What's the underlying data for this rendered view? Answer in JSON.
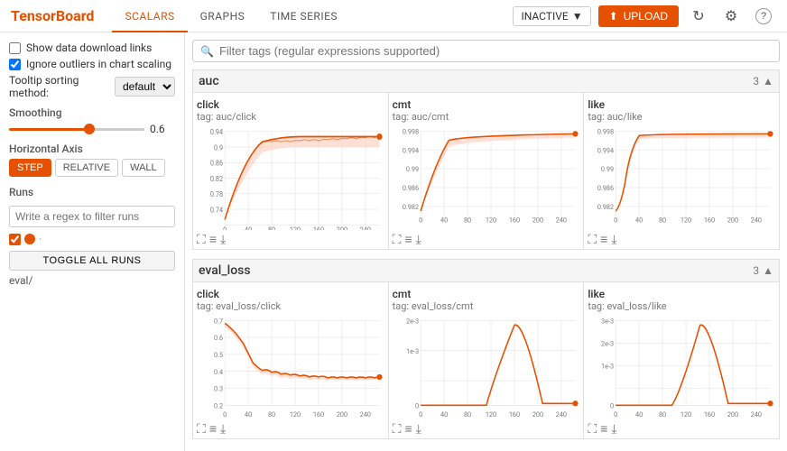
{
  "header": {
    "logo": "TensorBoard",
    "nav": [
      "SCALARS",
      "GRAPHS",
      "TIME SERIES"
    ],
    "active_nav": "SCALARS",
    "inactive_label": "INACTIVE",
    "upload_label": "UPLOAD"
  },
  "sidebar": {
    "show_download": "Show data download links",
    "ignore_outliers": "Ignore outliers in chart scaling",
    "tooltip_label": "Tooltip sorting method:",
    "tooltip_default": "default",
    "smoothing_label": "Smoothing",
    "smoothing_value": "0.6",
    "horizontal_axis_label": "Horizontal Axis",
    "axis_buttons": [
      "STEP",
      "RELATIVE",
      "WALL"
    ],
    "active_axis": "STEP",
    "runs_label": "Runs",
    "runs_placeholder": "Write a regex to filter runs",
    "toggle_runs": "TOGGLE ALL RUNS",
    "run_name": "eval/"
  },
  "search": {
    "placeholder": "Filter tags (regular expressions supported)"
  },
  "sections": [
    {
      "name": "auc",
      "count": "3",
      "charts": [
        {
          "title": "click",
          "tag": "tag: auc/click",
          "y_min": "0.74",
          "y_max": "0.94",
          "y_ticks": [
            "0.94",
            "0.9",
            "0.86",
            "0.82",
            "0.78",
            "0.74"
          ],
          "x_ticks": [
            "0",
            "40",
            "80",
            "120",
            "160",
            "200",
            "240"
          ]
        },
        {
          "title": "cmt",
          "tag": "tag: auc/cmt",
          "y_min": "0.982",
          "y_max": "0.998",
          "y_ticks": [
            "0.998",
            "0.994",
            "0.99",
            "0.986",
            "0.982"
          ],
          "x_ticks": [
            "0",
            "40",
            "80",
            "120",
            "160",
            "200",
            "240"
          ]
        },
        {
          "title": "like",
          "tag": "tag: auc/like",
          "y_min": "0.982",
          "y_max": "0.998",
          "y_ticks": [
            "0.998",
            "0.994",
            "0.99",
            "0.986",
            "0.982"
          ],
          "x_ticks": [
            "0",
            "40",
            "80",
            "120",
            "160",
            "200",
            "240"
          ]
        }
      ]
    },
    {
      "name": "eval_loss",
      "count": "3",
      "charts": [
        {
          "title": "click",
          "tag": "tag: eval_loss/click",
          "y_min": "0.2",
          "y_max": "0.7",
          "y_ticks": [
            "0.7",
            "0.6",
            "0.5",
            "0.4",
            "0.3",
            "0.2"
          ],
          "x_ticks": [
            "0",
            "40",
            "80",
            "120",
            "160",
            "200",
            "240"
          ]
        },
        {
          "title": "cmt",
          "tag": "tag: eval_loss/cmt",
          "y_min": "0",
          "y_max": "2e-3",
          "y_ticks": [
            "2e-3",
            "1e-3",
            "0"
          ],
          "x_ticks": [
            "0",
            "40",
            "80",
            "120",
            "160",
            "200",
            "240"
          ]
        },
        {
          "title": "like",
          "tag": "tag: eval_loss/like",
          "y_min": "0",
          "y_max": "3e-3",
          "y_ticks": [
            "3e-3",
            "2e-3",
            "1e-3",
            "0"
          ],
          "x_ticks": [
            "0",
            "40",
            "80",
            "120",
            "160",
            "200",
            "240"
          ]
        }
      ]
    }
  ],
  "icons": {
    "search": "🔍",
    "upload_icon": "⬆",
    "refresh": "↻",
    "settings": "⚙",
    "help": "?",
    "expand": "⛶",
    "data": "≡",
    "download": "⤓",
    "chevron_up": "▲",
    "chevron_down": "▼"
  },
  "colors": {
    "brand": "#e65100",
    "accent": "#e65100"
  }
}
